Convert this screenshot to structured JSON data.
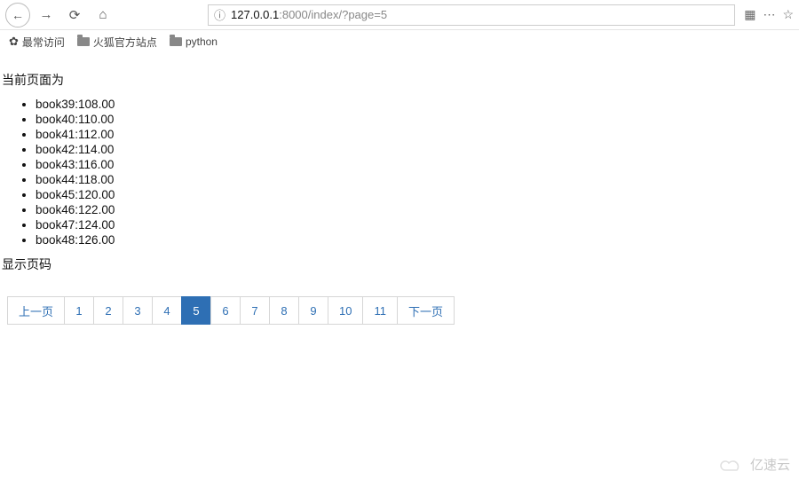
{
  "browser": {
    "url_info_icon": "ⓘ",
    "url_host": "127.0.0.1",
    "url_port": ":8000",
    "url_path": "/index/?page=5",
    "back_icon": "←",
    "forward_icon": "→",
    "reload_icon": "⟳",
    "home_icon": "⌂",
    "qr_icon": "▦",
    "more_icon": "⋯",
    "star_icon": "☆"
  },
  "bookmarks": {
    "items": [
      {
        "icon": "gear",
        "label": "最常访问"
      },
      {
        "icon": "folder",
        "label": "火狐官方站点"
      },
      {
        "icon": "folder",
        "label": "python"
      }
    ]
  },
  "page": {
    "heading": "当前页面为",
    "books": [
      "book39:108.00",
      "book40:110.00",
      "book41:112.00",
      "book42:114.00",
      "book43:116.00",
      "book44:118.00",
      "book45:120.00",
      "book46:122.00",
      "book47:124.00",
      "book48:126.00"
    ],
    "pager_label": "显示页码"
  },
  "pagination": {
    "prev": "上一页",
    "next": "下一页",
    "pages": [
      "1",
      "2",
      "3",
      "4",
      "5",
      "6",
      "7",
      "8",
      "9",
      "10",
      "11"
    ],
    "active": "5"
  },
  "watermark": "亿速云"
}
